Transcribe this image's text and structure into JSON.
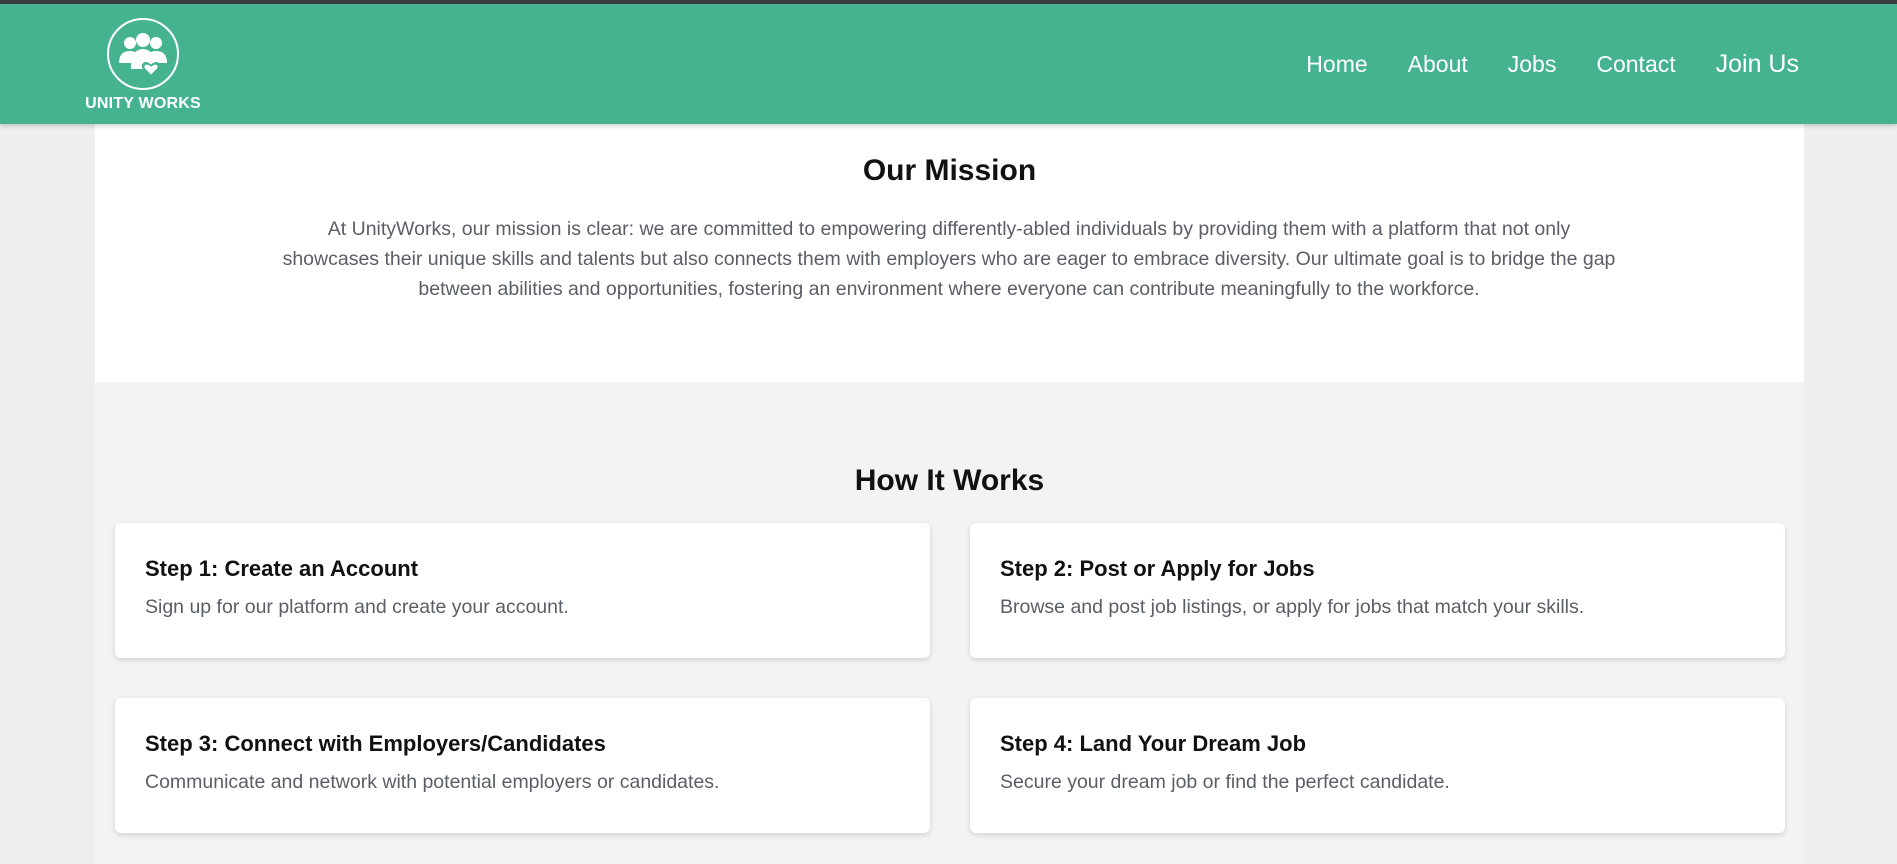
{
  "brand": {
    "name": "UNITY WORKS",
    "logo_icon": "people-heart-icon"
  },
  "colors": {
    "nav_bg": "#45b38f",
    "top_line": "#3a3d42",
    "section_bg": "#f2f3f5",
    "text_muted": "#5a5e66"
  },
  "nav": {
    "items": [
      {
        "label": "Home"
      },
      {
        "label": "About"
      },
      {
        "label": "Jobs"
      },
      {
        "label": "Contact"
      },
      {
        "label": "Join Us"
      }
    ]
  },
  "mission": {
    "title": "Our Mission",
    "text": "At UnityWorks, our mission is clear: we are committed to empowering differently-abled individuals by providing them with a platform that not only showcases their unique skills and talents but also connects them with employers who are eager to embrace diversity. Our ultimate goal is to bridge the gap between abilities and opportunities, fostering an environment where everyone can contribute meaningfully to the workforce."
  },
  "how_it_works": {
    "title": "How It Works",
    "steps": [
      {
        "title": "Step 1: Create an Account",
        "description": "Sign up for our platform and create your account."
      },
      {
        "title": "Step 2: Post or Apply for Jobs",
        "description": "Browse and post job listings, or apply for jobs that match your skills."
      },
      {
        "title": "Step 3: Connect with Employers/Candidates",
        "description": "Communicate and network with potential employers or candidates."
      },
      {
        "title": "Step 4: Land Your Dream Job",
        "description": "Secure your dream job or find the perfect candidate."
      }
    ]
  }
}
